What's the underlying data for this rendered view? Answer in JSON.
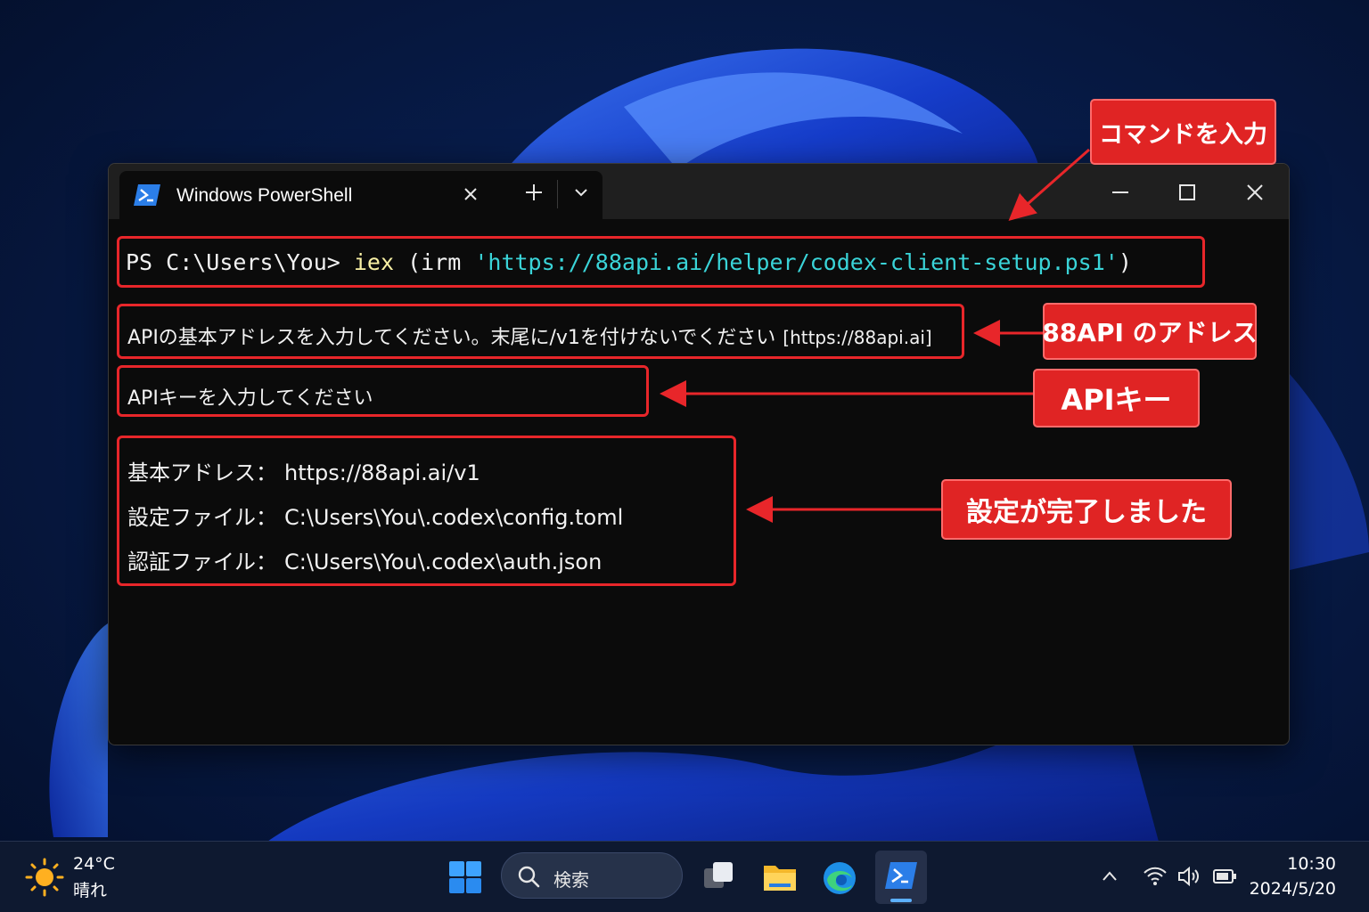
{
  "window": {
    "tab_title": "Windows PowerShell",
    "new_tab_label": "+",
    "colors": {
      "keyword": "#f9f1a5",
      "string": "#3ad4d8",
      "highlight": "#e8262a"
    }
  },
  "terminal": {
    "prompt": "PS C:\\Users\\You> ",
    "cmd_iex": "iex",
    "cmd_mid": " (irm ",
    "cmd_url": "'https://88api.ai/helper/codex-client-setup.ps1'",
    "cmd_end": ")",
    "base_prompt": "APIの基本アドレスを入力してください。末尾に/v1を付けないでください",
    "base_default": "[https://88api.ai]",
    "key_prompt": "APIキーを入力してください",
    "result": [
      {
        "label": "基本アドレス：",
        "value": "https://88api.ai/v1"
      },
      {
        "label": "設定ファイル：",
        "value": "C:\\Users\\You\\.codex\\config.toml"
      },
      {
        "label": "認証ファイル：",
        "value": "C:\\Users\\You\\.codex\\auth.json"
      }
    ]
  },
  "callouts": {
    "command": "コマンドを入力",
    "address": "88API のアドレス",
    "key": "APIキー",
    "done": "設定が完了しました"
  },
  "taskbar": {
    "weather_temp": "24°C",
    "weather_cond": "晴れ",
    "search_label": "検索",
    "time": "10:30",
    "date": "2024/5/20"
  }
}
